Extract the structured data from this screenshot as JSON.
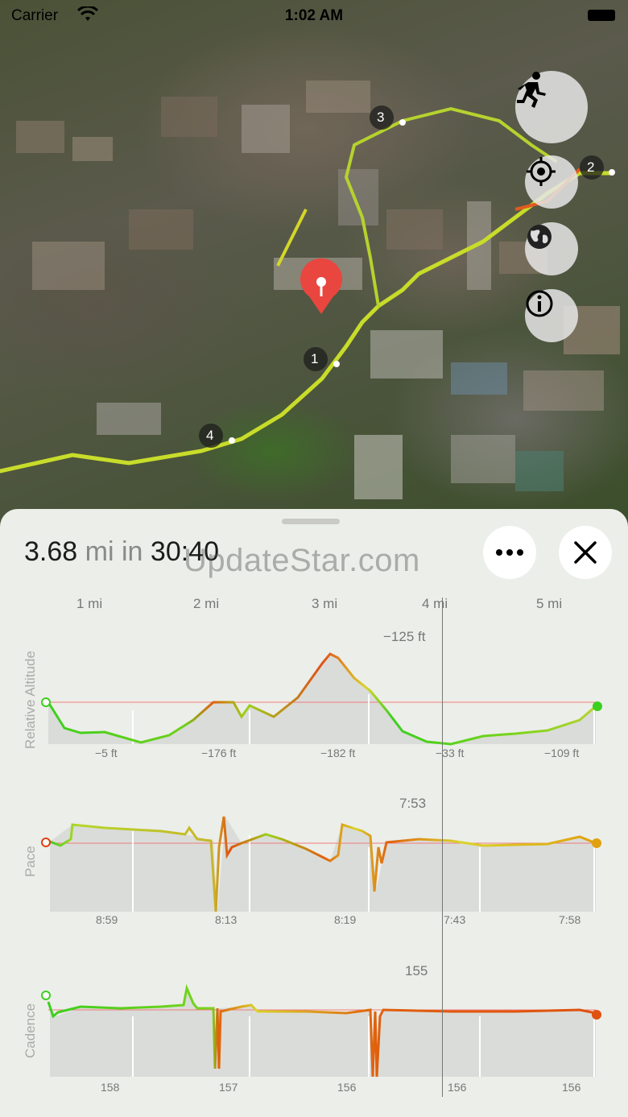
{
  "status_bar": {
    "carrier": "Carrier",
    "time": "1:02 AM"
  },
  "map": {
    "waypoints": [
      "1",
      "2",
      "3",
      "4"
    ],
    "controls": [
      "running-figure-icon",
      "locate-icon",
      "globe-icon",
      "info-icon"
    ]
  },
  "sheet": {
    "distance_value": "3.68",
    "distance_unit": "mi",
    "in_word": "in",
    "duration": "30:40",
    "watermark": "UpdateStar.com",
    "mile_markers": [
      "1 mi",
      "2 mi",
      "3 mi",
      "4 mi",
      "5 mi"
    ]
  },
  "charts": {
    "altitude": {
      "label": "Relative Altitude",
      "top_value": "−125 ft",
      "segment_values": [
        "−5 ft",
        "−176 ft",
        "−182 ft",
        "−33 ft",
        "−109 ft"
      ]
    },
    "pace": {
      "label": "Pace",
      "top_value": "7:53",
      "segment_values": [
        "8:59",
        "8:13",
        "8:19",
        "7:43",
        "7:58"
      ]
    },
    "cadence": {
      "label": "Cadence",
      "top_value": "155",
      "segment_values": [
        "158",
        "157",
        "156",
        "156",
        "156"
      ]
    }
  },
  "colors": {
    "accent_red": "#e8463f",
    "good_green": "#3ccf1e",
    "mid_yellow": "#d9d42a",
    "slow_orange": "#e0600e"
  }
}
